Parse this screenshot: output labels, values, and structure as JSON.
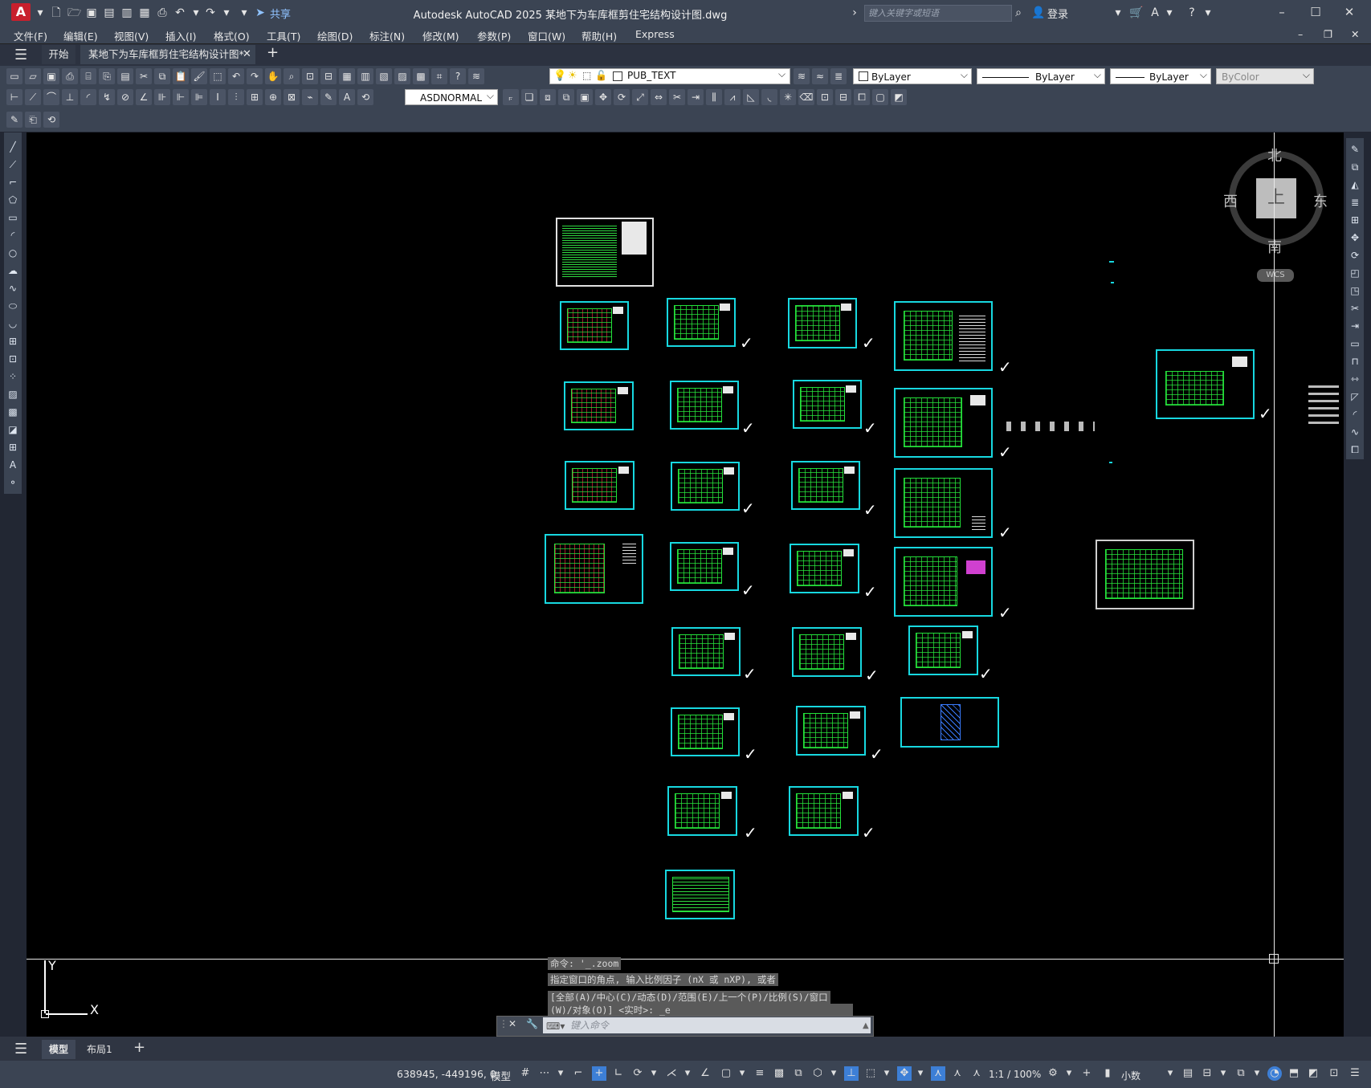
{
  "window": {
    "title": "Autodesk AutoCAD 2025    某地下为车库框剪住宅结构设计图.dwg",
    "search_placeholder": "键入关键字或短语",
    "login": "登录",
    "share": "共享",
    "app_letter": "A"
  },
  "menu": [
    "文件(F)",
    "编辑(E)",
    "视图(V)",
    "插入(I)",
    "格式(O)",
    "工具(T)",
    "绘图(D)",
    "标注(N)",
    "修改(M)",
    "参数(P)",
    "窗口(W)",
    "帮助(H)",
    "Express"
  ],
  "tabs": {
    "start": "开始",
    "drawing": "某地下为车库框剪住宅结构设计图*"
  },
  "properties": {
    "layer": "PUB_TEXT",
    "color": "ByLayer",
    "linetype": "ByLayer",
    "lineweight": "ByLayer",
    "plotstyle": "ByColor",
    "dimstyle": "ASDNORMAL"
  },
  "viewcube": {
    "north": "北",
    "south": "南",
    "east": "东",
    "west": "西",
    "top": "上",
    "wcs": "WCS"
  },
  "ucs": {
    "x": "X",
    "y": "Y"
  },
  "command": {
    "history": [
      "命令: '_.zoom",
      "指定窗口的角点, 输入比例因子 (nX 或 nXP), 或者",
      "[全部(A)/中心(C)/动态(D)/范围(E)/上一个(P)/比例(S)/窗口",
      "(W)/对象(O)] <实时>: _e"
    ],
    "placeholder": "键入命令"
  },
  "layout_tabs": {
    "model": "模型",
    "layout1": "布局1"
  },
  "status": {
    "coords": "638945, -449196, 0",
    "space": "模型",
    "scale": "1:1 / 100%",
    "units": "小数"
  },
  "colors": {
    "sheet_border": "#17d8e0",
    "plan_lines": "#23e13a",
    "canvas": "#000000",
    "ui_bg": "#3b4453"
  }
}
